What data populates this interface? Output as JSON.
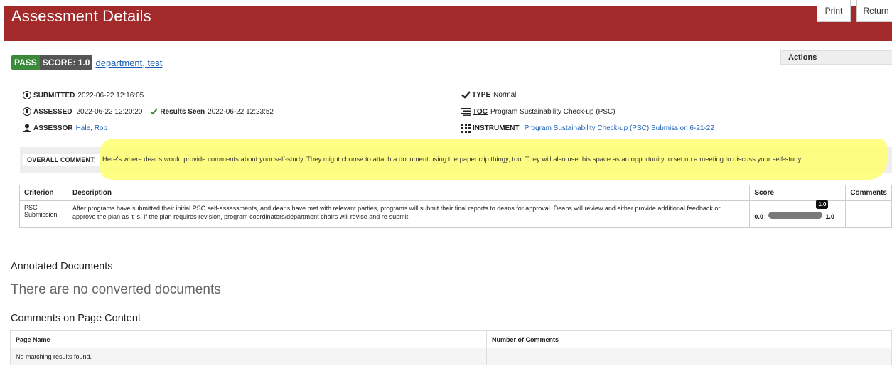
{
  "header": {
    "title": "Assessment Details",
    "print_label": "Print",
    "return_label": "Return",
    "color": "#a22a2a"
  },
  "result": {
    "pass_label": "PASS",
    "score_label": "SCORE: 1.0",
    "department_link": "department, test"
  },
  "actions_label": "Actions",
  "meta": {
    "submitted_label": "SUBMITTED",
    "submitted_value": "2022-06-22 12:16:05",
    "assessed_label": "ASSESSED",
    "assessed_value": "2022-06-22 12:20:20",
    "results_seen_label": "Results Seen",
    "results_seen_value": "2022-06-22 12:23:52",
    "assessor_label": "ASSESSOR",
    "assessor_value": "Hale, Rob",
    "type_label": "TYPE",
    "type_value": "Normal",
    "toc_label": "TOC",
    "toc_value": "Program Sustainability Check-up (PSC)",
    "instrument_label": "INSTRUMENT",
    "instrument_value": "Program Sustainability Check-up (PSC) Submission 6-21-22"
  },
  "overall_comment": {
    "label": "OVERALL COMMENT:",
    "text": "Here's where deans would provide comments about your self-study. They might choose to attach a document using the paper clip thingy, too. They will also use this space as an opportunity to set up a meeting to discuss your self-study."
  },
  "criteria_table": {
    "headers": [
      "Criterion",
      "Description",
      "Score",
      "Comments"
    ],
    "rows": [
      {
        "criterion": "PSC Submission",
        "description": "After programs have submitted their initial PSC self-assessments, and deans have met with relevant parties, programs will submit their final reports to deans for approval.  Deans will review and either provide additional feedback or approve the plan as it is. If the plan requires revision, program coordinators/department chairs will revise and re-submit.",
        "score_min": "0.0",
        "score_max": "1.0",
        "score_value": "1.0",
        "score_fraction": 1.0,
        "comments": ""
      }
    ]
  },
  "annotated_documents": {
    "heading": "Annotated Documents",
    "empty_text": "There are no converted documents"
  },
  "page_comments": {
    "heading": "Comments on Page Content",
    "headers": [
      "Page Name",
      "Number of Comments"
    ],
    "empty_text": "No matching results found."
  }
}
